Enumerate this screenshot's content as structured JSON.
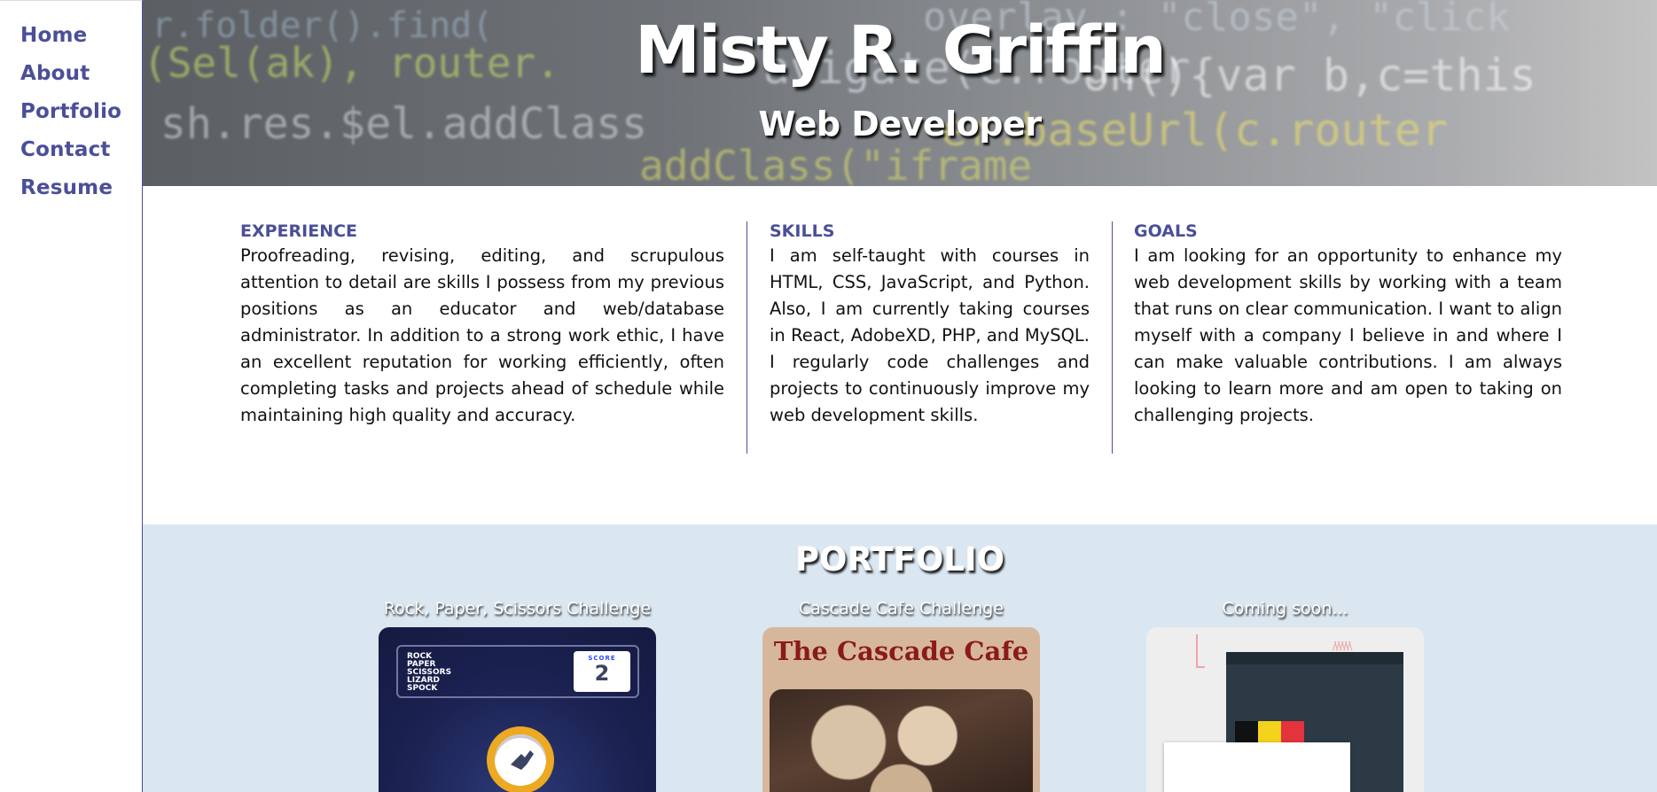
{
  "nav": {
    "items": [
      {
        "label": "Home"
      },
      {
        "label": "About"
      },
      {
        "label": "Portfolio"
      },
      {
        "label": "Contact"
      },
      {
        "label": "Resume"
      }
    ]
  },
  "hero": {
    "name": "Misty R. Griffin",
    "role": "Web Developer"
  },
  "about": {
    "experience": {
      "heading": "EXPERIENCE",
      "text": "Proofreading, revising, editing, and scrupulous attention to detail are skills I possess from my previous positions as an educator and web/database administrator. In addition to a strong work ethic, I have an excellent reputation for working efficiently, often completing tasks and projects ahead of schedule while maintaining high quality and accuracy."
    },
    "skills": {
      "heading": "SKILLS",
      "text": "I am self-taught with courses in HTML, CSS, JavaScript, and Python. Also, I am currently taking courses in React, AdobeXD, PHP, and MySQL. I regularly code challenges and projects to continuously improve my web development skills."
    },
    "goals": {
      "heading": "GOALS",
      "text": "I am looking for an opportunity to enhance my web development skills by working with a team that runs on clear communication. I want to align myself with a company I believe in and where I can make valuable contributions. I am always looking to learn more and am open to taking on challenging projects."
    }
  },
  "portfolio": {
    "title": "PORTFOLIO",
    "cards": [
      {
        "label": "Rock, Paper, Scissors Challenge",
        "thumb_words": [
          "ROCK",
          "PAPER",
          "SCISSORS",
          "LIZARD",
          "SPOCK"
        ],
        "thumb_score_label": "SCORE",
        "thumb_score_value": "2"
      },
      {
        "label": "Cascade Cafe Challenge",
        "thumb_title": "The Cascade Cafe"
      },
      {
        "label": "Coming soon..."
      }
    ]
  },
  "colors": {
    "accent": "#4b4f98",
    "portfolio_bg": "#dae6f0",
    "cafe_title": "#8b1a1a"
  }
}
